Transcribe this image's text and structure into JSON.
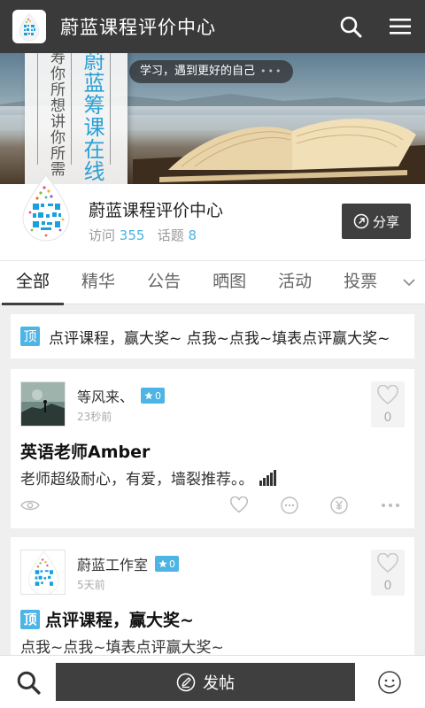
{
  "header": {
    "title": "蔚蓝课程评价中心",
    "logo_icon": "qr-drop-logo-icon",
    "search_icon": "search-icon",
    "menu_icon": "menu-icon"
  },
  "banner": {
    "card_gray_text": "寿你所想讲你所需",
    "card_blue_text": "蔚蓝筹课在线",
    "pill_text": "学习，遇到更好的自己",
    "pill_dots": "•••"
  },
  "profile": {
    "name": "蔚蓝课程评价中心",
    "visits_label": "访问",
    "visits": "355",
    "topics_label": "话题",
    "topics": "8",
    "share_label": "分享"
  },
  "tabs": [
    "全部",
    "精华",
    "公告",
    "晒图",
    "活动",
    "投票"
  ],
  "pinned": {
    "tag": "顶",
    "text": "点评课程，赢大奖~ 点我~点我~填表点评赢大奖~"
  },
  "posts": [
    {
      "author": "等风来、",
      "level": "0",
      "time": "23秒前",
      "likes": "0",
      "title": "英语老师Amber",
      "body": "老师超级耐心，有爱，墙裂推荐。。"
    },
    {
      "author": "蔚蓝工作室",
      "level": "0",
      "time": "5天前",
      "likes": "0",
      "tag": "顶",
      "title": "点评课程，赢大奖~",
      "body": "点我~点我~填表点评赢大奖~"
    }
  ],
  "bottom": {
    "post_label": "发帖"
  },
  "colors": {
    "header_bg": "#3a3a3a",
    "accent_blue": "#4db4e6",
    "dark_button": "#3f3f3f"
  }
}
